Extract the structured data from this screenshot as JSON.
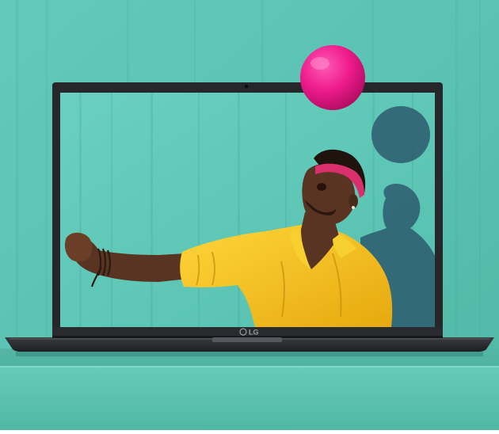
{
  "laptop": {
    "brand": "LG"
  },
  "colors": {
    "wall": "#5fc7b6",
    "wall_dark": "#3fa998",
    "counter": "#59c0ad",
    "bezel": "#2a2b2e",
    "ball": "#ef1f8e",
    "shirt": "#f4c51c",
    "skin": "#5a3422",
    "headband": "#d92f6c",
    "shadow": "#2f5f72"
  }
}
